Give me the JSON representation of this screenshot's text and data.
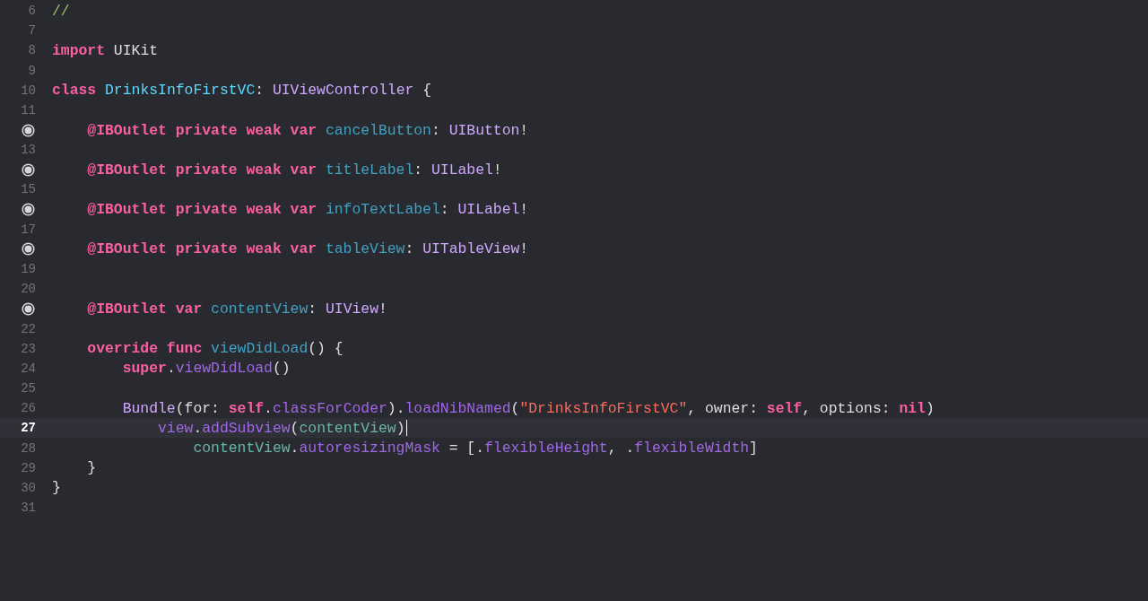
{
  "editor": {
    "lines": [
      {
        "number": "6",
        "outlet": false,
        "current": false,
        "tokens": [
          {
            "text": "//",
            "kind": "comment"
          }
        ]
      },
      {
        "number": "7",
        "outlet": false,
        "current": false
      },
      {
        "number": "8",
        "outlet": false,
        "current": false,
        "tokens": [
          {
            "text": "import",
            "kind": "keyword"
          },
          {
            "text": " UIKit",
            "kind": "plain"
          }
        ]
      },
      {
        "number": "9",
        "outlet": false,
        "current": false
      },
      {
        "number": "10",
        "outlet": false,
        "current": false,
        "tokens": [
          {
            "text": "class ",
            "kind": "keyword"
          },
          {
            "text": "DrinksInfoFirstVC",
            "kind": "typedecl"
          },
          {
            "text": ": ",
            "kind": "plain"
          },
          {
            "text": "UIViewController",
            "kind": "type"
          },
          {
            "text": " {",
            "kind": "plain"
          }
        ]
      },
      {
        "number": "11",
        "outlet": false,
        "current": false
      },
      {
        "outlet": true,
        "current": false,
        "tokens": [
          {
            "text": "    @IBOutlet private weak var ",
            "kind": "keyword"
          },
          {
            "text": "cancelButton",
            "kind": "decl"
          },
          {
            "text": ": ",
            "kind": "plain"
          },
          {
            "text": "UIButton",
            "kind": "type"
          },
          {
            "text": "!",
            "kind": "plain"
          }
        ]
      },
      {
        "number": "13",
        "outlet": false,
        "current": false
      },
      {
        "outlet": true,
        "current": false,
        "tokens": [
          {
            "text": "    @IBOutlet private weak var ",
            "kind": "keyword"
          },
          {
            "text": "titleLabel",
            "kind": "decl"
          },
          {
            "text": ": ",
            "kind": "plain"
          },
          {
            "text": "UILabel",
            "kind": "type"
          },
          {
            "text": "!",
            "kind": "plain"
          }
        ]
      },
      {
        "number": "15",
        "outlet": false,
        "current": false
      },
      {
        "outlet": true,
        "current": false,
        "tokens": [
          {
            "text": "    @IBOutlet private weak var ",
            "kind": "keyword"
          },
          {
            "text": "infoTextLabel",
            "kind": "decl"
          },
          {
            "text": ": ",
            "kind": "plain"
          },
          {
            "text": "UILabel",
            "kind": "type"
          },
          {
            "text": "!",
            "kind": "plain"
          }
        ]
      },
      {
        "number": "17",
        "outlet": false,
        "current": false
      },
      {
        "outlet": true,
        "current": false,
        "tokens": [
          {
            "text": "    @IBOutlet private weak var ",
            "kind": "keyword"
          },
          {
            "text": "tableView",
            "kind": "decl"
          },
          {
            "text": ": ",
            "kind": "plain"
          },
          {
            "text": "UITableView",
            "kind": "type"
          },
          {
            "text": "!",
            "kind": "plain"
          }
        ]
      },
      {
        "number": "19",
        "outlet": false,
        "current": false
      },
      {
        "number": "20",
        "outlet": false,
        "current": false
      },
      {
        "outlet": true,
        "current": false,
        "tokens": [
          {
            "text": "    @IBOutlet var ",
            "kind": "keyword"
          },
          {
            "text": "contentView",
            "kind": "decl"
          },
          {
            "text": ": ",
            "kind": "plain"
          },
          {
            "text": "UIView",
            "kind": "type"
          },
          {
            "text": "!",
            "kind": "plain"
          }
        ]
      },
      {
        "number": "22",
        "outlet": false,
        "current": false
      },
      {
        "number": "23",
        "outlet": false,
        "current": false,
        "tokens": [
          {
            "text": "    override func ",
            "kind": "keyword"
          },
          {
            "text": "viewDidLoad",
            "kind": "decl"
          },
          {
            "text": "() {",
            "kind": "plain"
          }
        ]
      },
      {
        "number": "24",
        "outlet": false,
        "current": false,
        "tokens": [
          {
            "text": "        super",
            "kind": "keyword"
          },
          {
            "text": ".",
            "kind": "plain"
          },
          {
            "text": "viewDidLoad",
            "kind": "member"
          },
          {
            "text": "()",
            "kind": "plain"
          }
        ]
      },
      {
        "number": "25",
        "outlet": false,
        "current": false
      },
      {
        "number": "26",
        "outlet": false,
        "current": false,
        "tokens": [
          {
            "text": "        Bundle",
            "kind": "type"
          },
          {
            "text": "(for: ",
            "kind": "plain"
          },
          {
            "text": "self",
            "kind": "keyword"
          },
          {
            "text": ".",
            "kind": "plain"
          },
          {
            "text": "classForCoder",
            "kind": "member"
          },
          {
            "text": ").",
            "kind": "plain"
          },
          {
            "text": "loadNibNamed",
            "kind": "member"
          },
          {
            "text": "(",
            "kind": "plain"
          },
          {
            "text": "\"DrinksInfoFirstVC\"",
            "kind": "string"
          },
          {
            "text": ", owner: ",
            "kind": "plain"
          },
          {
            "text": "self",
            "kind": "keyword"
          },
          {
            "text": ", options: ",
            "kind": "plain"
          },
          {
            "text": "nil",
            "kind": "keyword"
          },
          {
            "text": ")",
            "kind": "plain"
          }
        ]
      },
      {
        "number": "27",
        "outlet": false,
        "current": true,
        "tokens": [
          {
            "text": "            view",
            "kind": "member"
          },
          {
            "text": ".",
            "kind": "plain"
          },
          {
            "text": "addSubview",
            "kind": "member"
          },
          {
            "text": "(",
            "kind": "plain"
          },
          {
            "text": "contentView",
            "kind": "ref"
          },
          {
            "text": ")",
            "kind": "plain"
          }
        ]
      },
      {
        "number": "28",
        "outlet": false,
        "current": false,
        "tokens": [
          {
            "text": "                contentView",
            "kind": "ref"
          },
          {
            "text": ".",
            "kind": "plain"
          },
          {
            "text": "autoresizingMask",
            "kind": "member"
          },
          {
            "text": " = [.",
            "kind": "plain"
          },
          {
            "text": "flexibleHeight",
            "kind": "member"
          },
          {
            "text": ", .",
            "kind": "plain"
          },
          {
            "text": "flexibleWidth",
            "kind": "member"
          },
          {
            "text": "]",
            "kind": "plain"
          }
        ]
      },
      {
        "number": "29",
        "outlet": false,
        "current": false,
        "tokens": [
          {
            "text": "    }",
            "kind": "plain"
          }
        ]
      },
      {
        "number": "30",
        "outlet": false,
        "current": false,
        "tokens": [
          {
            "text": "}",
            "kind": "plain"
          }
        ]
      },
      {
        "number": "31",
        "outlet": false,
        "current": false
      }
    ]
  }
}
